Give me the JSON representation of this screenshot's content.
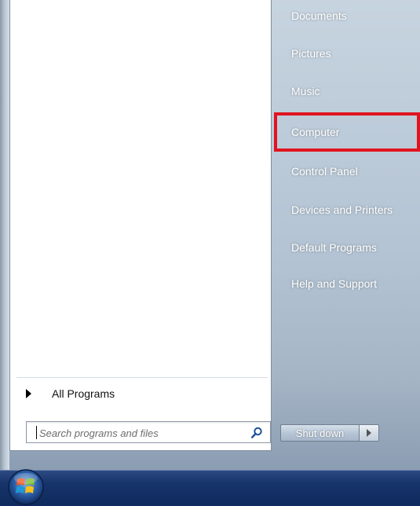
{
  "right_pane": {
    "items": [
      {
        "label": "Documents"
      },
      {
        "label": "Pictures"
      },
      {
        "label": "Music"
      },
      {
        "label": "Computer"
      },
      {
        "label": "Control Panel"
      },
      {
        "label": "Devices and Printers"
      },
      {
        "label": "Default Programs"
      },
      {
        "label": "Help and Support"
      }
    ],
    "highlighted_item": "Computer",
    "highlight_color": "#e0141f"
  },
  "left_pane": {
    "all_programs_label": "All Programs",
    "search": {
      "placeholder": "Search programs and files",
      "value": "",
      "icon": "search-icon"
    }
  },
  "shutdown": {
    "label": "Shut down",
    "options_icon": "right-arrow-icon"
  },
  "taskbar": {
    "start_icon": "windows-start-orb-icon"
  },
  "colors": {
    "taskbar": "#17346b",
    "menu_frame": "#b3c3d3",
    "right_item_text": "#ffffff"
  }
}
